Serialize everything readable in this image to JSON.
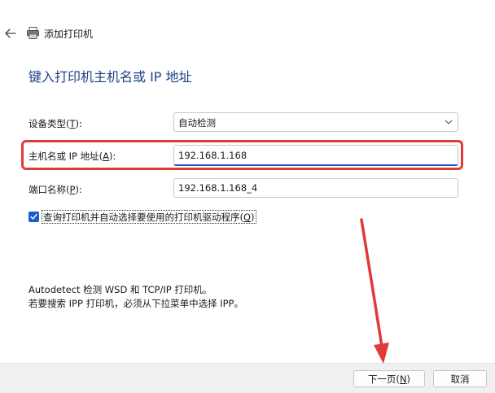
{
  "window": {
    "title": "添加打印机"
  },
  "heading": "键入打印机主机名或 IP 地址",
  "device_type": {
    "label_pre": "设备类型(",
    "label_key": "T",
    "label_post": "):",
    "value": "自动检测"
  },
  "host": {
    "label_pre": "主机名或 IP 地址(",
    "label_key": "A",
    "label_post": "):",
    "value": "192.168.1.168"
  },
  "port": {
    "label_pre": "端口名称(",
    "label_key": "P",
    "label_post": "):",
    "value": "192.168.1.168_4"
  },
  "query_checkbox": {
    "checked": true,
    "label_pre": "查询打印机并自动选择要使用的打印机驱动程序(",
    "label_key": "Q",
    "label_post": ")"
  },
  "info": {
    "line1": "Autodetect 检测 WSD 和 TCP/IP 打印机。",
    "line2": "若要搜索 IPP 打印机，必须从下拉菜单中选择 IPP。"
  },
  "buttons": {
    "next_pre": "下一页(",
    "next_key": "N",
    "next_post": ")",
    "cancel": "取消"
  },
  "colors": {
    "heading": "#1f3f8a",
    "accent": "#1a5fc7",
    "annotation": "#e03a3a"
  },
  "icons": {
    "back": "back-arrow-icon",
    "printer": "printer-icon",
    "dropdown": "chevron-down-icon",
    "check": "checkmark-icon"
  }
}
